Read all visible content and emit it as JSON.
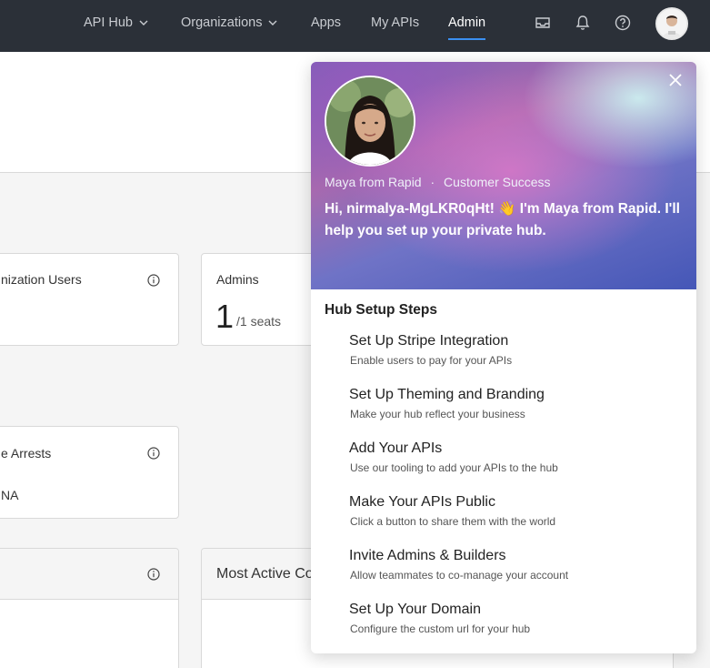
{
  "nav": {
    "items": [
      {
        "label": "API Hub",
        "dropdown": true
      },
      {
        "label": "Organizations",
        "dropdown": true
      },
      {
        "label": "Apps",
        "dropdown": false
      },
      {
        "label": "My APIs",
        "dropdown": false
      },
      {
        "label": "Admin",
        "dropdown": false,
        "active": true
      }
    ],
    "icons": [
      "inbox-icon",
      "bell-icon",
      "help-icon"
    ],
    "accent": "#3b8ff0",
    "bg": "#2b3038"
  },
  "dashboard": {
    "card_users_title": "nization Users",
    "card_admins_title": "Admins",
    "admins_count": "1",
    "admins_seats": "/1 seats",
    "card_arrests_title": "e Arrests",
    "arrests_value": "NA",
    "card_active_title": "Most Active Co"
  },
  "popup": {
    "from": "Maya from Rapid",
    "separator": "·",
    "role": "Customer Success",
    "greeting": "Hi, nirmalya-MgLKR0qHt! 👋 I'm Maya from Rapid. I'll help you set up your private hub.",
    "steps_title": "Hub Setup Steps",
    "steps": [
      {
        "title": "Set Up Stripe Integration",
        "desc": "Enable users to pay for your APIs"
      },
      {
        "title": "Set Up Theming and Branding",
        "desc": "Make your hub reflect your business"
      },
      {
        "title": "Add Your APIs",
        "desc": "Use our tooling to add your APIs to the hub"
      },
      {
        "title": "Make Your APIs Public",
        "desc": "Click a button to share them with the world"
      },
      {
        "title": "Invite Admins & Builders",
        "desc": "Allow teammates to co-manage your account"
      },
      {
        "title": "Set Up Your Domain",
        "desc": "Configure the custom url for your hub"
      }
    ]
  }
}
